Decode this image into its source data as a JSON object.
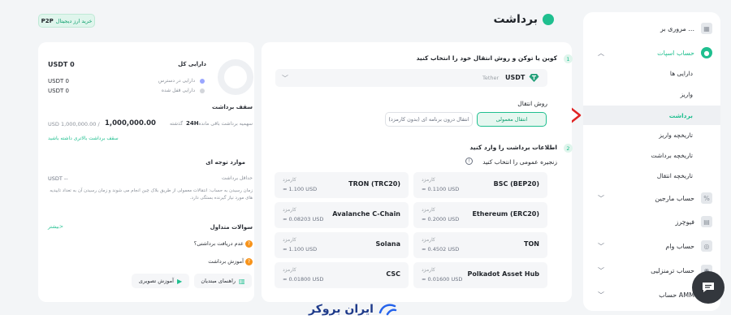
{
  "header": {
    "title": "برداشت",
    "p2p_label": "P2P",
    "p2p_text": "خرید ارز دیجیتال"
  },
  "sidebar": {
    "items": [
      {
        "label": "مروری بر ...",
        "icon": "overview-icon"
      },
      {
        "label": "حساب اسپات",
        "icon": "spot-icon",
        "active": true
      },
      {
        "label": "حساب مارجین",
        "icon": "margin-icon"
      },
      {
        "label": "فیوچرز",
        "icon": "futures-icon"
      },
      {
        "label": "حساب وام",
        "icon": "loan-icon"
      },
      {
        "label": "حساب ترمنزلیی",
        "icon": "terminal-icon"
      },
      {
        "label": "حساب AMM",
        "icon": "amm-icon"
      }
    ],
    "subitems": [
      "دارایی ها",
      "واریز",
      "برداشت",
      "تاریخچه واریز",
      "تاریخچه برداشت",
      "تاریخچه انتقال"
    ]
  },
  "step1": {
    "num": "1",
    "title": "کوین یا توکن و روش انتقال خود را انتخاب کنید",
    "coin_code": "USDT",
    "coin_name": "Tether",
    "method_label": "روش انتقال",
    "method_normal": "انتقال معمولی",
    "method_internal": "انتقال درون برنامه ای (بدون کارمزد)"
  },
  "step2": {
    "num": "2",
    "title": "اطلاعات برداشت را وارد کنید",
    "chain_label": "زنجیره عمومی را انتخاب کنید",
    "fee_label": "کارمزد",
    "networks": [
      {
        "name": "BSC (BEP20)",
        "fee": "≈ 0.1100 USD"
      },
      {
        "name": "TRON (TRC20)",
        "fee": "≈ 1.100 USD"
      },
      {
        "name": "Ethereum (ERC20)",
        "fee": "≈ 0.2000 USD"
      },
      {
        "name": "Avalanche C-Chain",
        "fee": "≈ 0.08203 USD"
      },
      {
        "name": "TON",
        "fee": "≈ 0.4502 USD"
      },
      {
        "name": "Solana",
        "fee": "≈ 1.100 USD"
      },
      {
        "name": "Polkadot Asset Hub",
        "fee": "≈ 0.01600 USD"
      },
      {
        "name": "CSC",
        "fee": "≈ 0.01800 USD"
      }
    ]
  },
  "assets": {
    "total_label": "دارایی کل",
    "total_value": "USDT 0",
    "available_label": "دارایی در دسترس",
    "available_value": "USDT 0",
    "locked_label": "دارایی قفل شده",
    "locked_value": "USDT 0",
    "limit_title": "سقف برداشت",
    "limit_desc": "سهمیه برداشت باقی مانده",
    "limit_period": "24H",
    "limit_period_suffix": "گذشته",
    "limit_value": "1,000,000.00",
    "limit_max": "USD 1,000,000.00 /",
    "limit_link": "سقف برداشت بالاتری داشته باشید",
    "notes_title": "موارد توجه ای",
    "min_label": "حداقل برداشت",
    "min_value": "USDT --",
    "notes_text": "زمان رسیدن به حساب: انتقالات معمولی از طریق بلاک چین انجام می شوند و زمان رسیدن آن به تعداد تاییدیه های مورد نیاز گیرنده بستگی دارد.",
    "faq_title": "سوالات متداول",
    "faq_more": "بیشتر>",
    "faq_items": [
      "عدم دریافت برداشتی؟",
      "آموزش برداشت"
    ],
    "guide_btn": "راهنمای مبتدیان",
    "video_btn": "آموزش تصویری"
  },
  "footer": {
    "logo_text": "ایران بروکر"
  },
  "colors": {
    "accent": "#1fbf8f",
    "arrow": "#e02424"
  }
}
